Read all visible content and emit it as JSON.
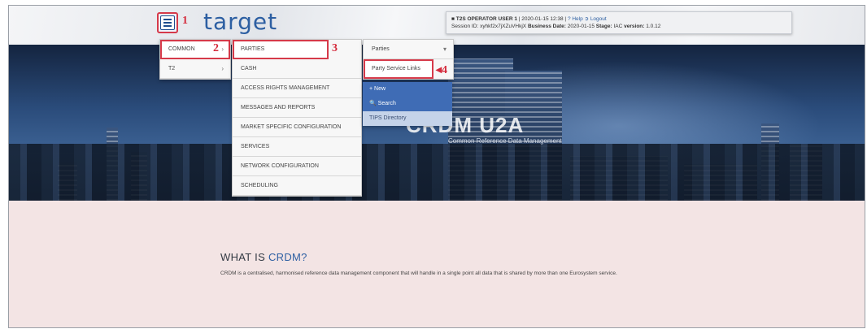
{
  "app": {
    "logo_text": "target"
  },
  "steps": {
    "s1": "1",
    "s2": "2",
    "s3": "3",
    "s4": "4"
  },
  "header": {
    "user_label": "T2S OPERATOR USER 1",
    "timestamp": "| 2020-01-15 12:38 |",
    "help_label": "? Help",
    "logout_label": "Logout",
    "session_label": "Session ID:",
    "session_value": "xyhkf2x7jXZuVHkjX",
    "business_date_label": "Business Date:",
    "business_date_value": "2020-01-15",
    "stage_label": "Stage:",
    "stage_value": "IAC",
    "version_label": "version:",
    "version_value": "1.0.12"
  },
  "menu": {
    "level1": [
      {
        "label": "COMMON"
      },
      {
        "label": "T2"
      }
    ],
    "level2": [
      {
        "label": "PARTIES"
      },
      {
        "label": "CASH"
      },
      {
        "label": "ACCESS RIGHTS MANAGEMENT"
      },
      {
        "label": "MESSAGES AND REPORTS"
      },
      {
        "label": "MARKET SPECIFIC CONFIGURATION"
      },
      {
        "label": "SERVICES"
      },
      {
        "label": "NETWORK CONFIGURATION"
      },
      {
        "label": "SCHEDULING"
      }
    ],
    "level3": [
      {
        "label": "Parties"
      },
      {
        "label": "Party Service Links"
      }
    ],
    "level4": [
      {
        "label": "+ New"
      },
      {
        "label": "Search"
      },
      {
        "label": "TIPS Directory"
      }
    ]
  },
  "hero": {
    "title": "CRDM U2A",
    "subtitle": "Common Reference Data Management"
  },
  "content": {
    "title_prefix": "WHAT IS ",
    "title_accent": "CRDM?",
    "body": "CRDM is a centralised, harmonised reference data management component that will handle in a single point all data that is shared by more than one Eurosystem service."
  },
  "colors": {
    "accent": "#2d5fa2",
    "highlight": "#d63a4a",
    "menu_blue": "#3f6cb5"
  }
}
